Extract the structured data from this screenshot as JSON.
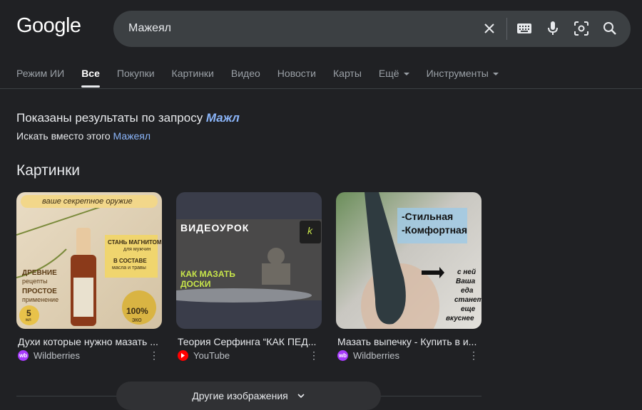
{
  "logo": "Google",
  "search": {
    "query": "Мажеял"
  },
  "tabs": [
    {
      "label": "Режим ИИ"
    },
    {
      "label": "Все"
    },
    {
      "label": "Покупки"
    },
    {
      "label": "Картинки"
    },
    {
      "label": "Видео"
    },
    {
      "label": "Новости"
    },
    {
      "label": "Карты"
    },
    {
      "label": "Ещё"
    },
    {
      "label": "Инструменты"
    }
  ],
  "correction": {
    "shown_prefix": "Показаны результаты по запросу ",
    "corrected": "Мажл",
    "instead_prefix": "Искать вместо этого ",
    "original": "Мажеял"
  },
  "images_section": {
    "title": "Картинки",
    "items": [
      {
        "caption": "Духи которые нужно мазать ...",
        "source": "Wildberries",
        "source_badge": "wb",
        "thumb_texts": [
          "ваше секретное оружие",
          "СТАНЬ МАГНИТОМ",
          "для мужчин",
          "В СОСТАВЕ",
          "масла и травы",
          "ДРЕВНИЕ",
          "рецепты",
          "ПРОСТОЕ",
          "применение",
          "5",
          "мл",
          "100%",
          "эко"
        ]
      },
      {
        "caption": "Теория Серфинга “КАК ПЕД...",
        "source": "YouTube",
        "source_badge": "yt",
        "thumb_texts": [
          "ВИДЕОУРОК",
          "КАК МАЗАТЬ",
          "ДОСКИ",
          "k"
        ]
      },
      {
        "caption": "Мазать выпечку - Купить в и...",
        "source": "Wildberries",
        "source_badge": "wb",
        "thumb_texts": [
          "-Стильная",
          "-Комфортная",
          "с ней",
          "Ваша",
          "еда",
          "станет",
          "еще",
          "вкуснее"
        ]
      }
    ],
    "more_button": "Другие изображения"
  },
  "colors": {
    "background": "#202124",
    "link": "#8ab4f8",
    "wildberries": "#a73afd",
    "youtube": "#ff0000"
  }
}
